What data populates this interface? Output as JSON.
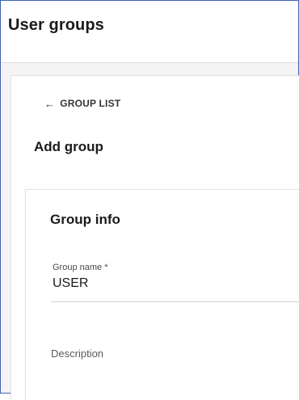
{
  "header": {
    "title": "User groups"
  },
  "nav": {
    "back_label": "GROUP LIST",
    "back_icon": "arrow-left-icon"
  },
  "section": {
    "title": "Add group"
  },
  "group_info": {
    "title": "Group info",
    "group_name": {
      "label": "Group name *",
      "value": "USER"
    },
    "description": {
      "placeholder": "Description",
      "value": ""
    }
  },
  "colors": {
    "frame_border": "#3f63b5",
    "page_bg": "#f4f4f4",
    "text": "#1b1b1b"
  }
}
